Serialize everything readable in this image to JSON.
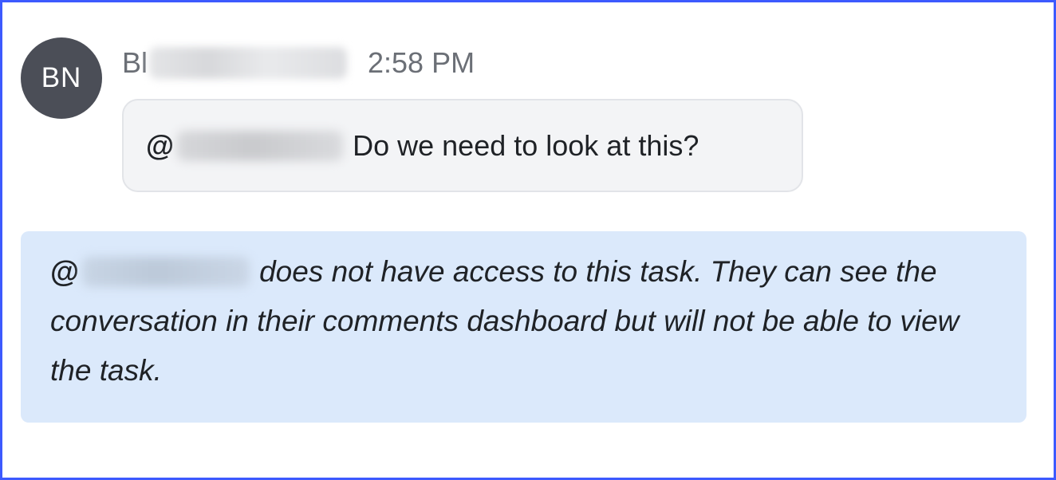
{
  "comment": {
    "avatar_initials": "BN",
    "author_visible": "Bl",
    "timestamp": "2:58 PM",
    "mention_prefix": "@",
    "text": "Do we need to look at this?"
  },
  "notice": {
    "mention_prefix": "@",
    "text": "does not have access to this task. They can see the conversation in their comments dashboard but will not be able to view the task."
  },
  "colors": {
    "frame_border": "#3d5afe",
    "avatar_bg": "#4b4e57",
    "bubble_bg": "#f3f4f6",
    "notice_bg": "#dbe9fb"
  }
}
